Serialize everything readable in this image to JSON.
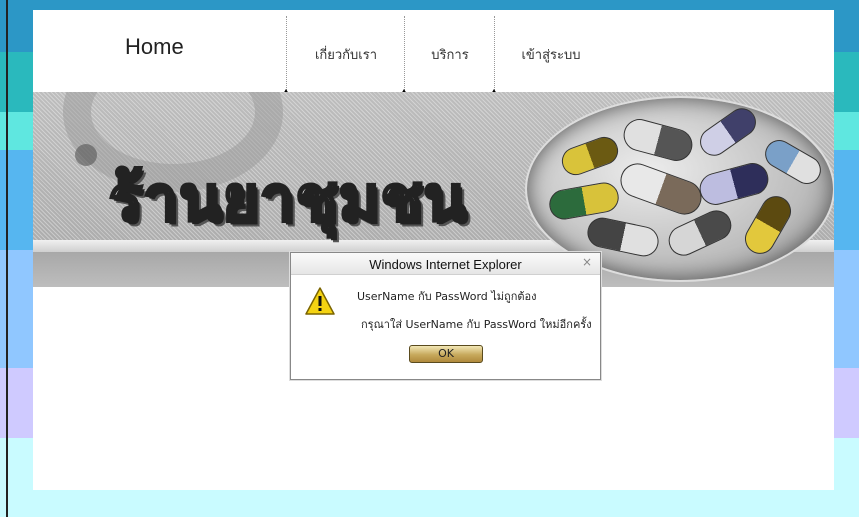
{
  "nav": {
    "home": "Home",
    "items": [
      "เกี่ยวกับเรา",
      "บริการ",
      "เข้าสู่ระบบ"
    ]
  },
  "banner": {
    "title": "ร้านยาชุมชน"
  },
  "dialog": {
    "title": "Windows Internet Explorer",
    "close": "×",
    "message_line1": "UserName กับ PassWord  ไม่ถูกต้อง",
    "message_line2": "กรุณาใส่  UserName กับ PassWord ใหม่อีกครั้ง",
    "ok_label": "OK",
    "icon": "warning-icon"
  },
  "colors": {
    "warning_yellow": "#f5d312",
    "ok_button": "#c7a95c"
  }
}
